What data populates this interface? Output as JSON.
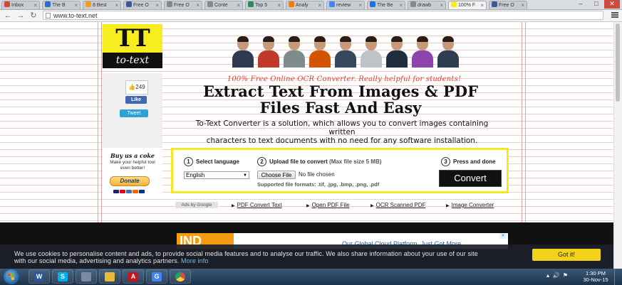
{
  "browser": {
    "tabs": [
      {
        "label": "Inbox",
        "color": "#d44638"
      },
      {
        "label": "The B",
        "color": "#2a6ed1"
      },
      {
        "label": "8 Best",
        "color": "#f0a020"
      },
      {
        "label": "Free O",
        "color": "#3b5998"
      },
      {
        "label": "Free O",
        "color": "#888888"
      },
      {
        "label": "Conte",
        "color": "#888888"
      },
      {
        "label": "Top 5",
        "color": "#2e8b57"
      },
      {
        "label": "Analy",
        "color": "#f57c00"
      },
      {
        "label": "review",
        "color": "#4285f4"
      },
      {
        "label": "The Be",
        "color": "#1a73e8"
      },
      {
        "label": "drawb",
        "color": "#888888"
      },
      {
        "label": "100% F",
        "color": "#f7ed1f"
      },
      {
        "label": "Free O",
        "color": "#3b5998"
      }
    ],
    "url": "www.to-text.net"
  },
  "site": {
    "logo_top": "TT",
    "logo_bottom": "to-text",
    "like_count": "249",
    "fb_like": "Like",
    "tweet": "Tweet",
    "tagline": "100% Free Online OCR Converter. Really helpful for students!",
    "headline_line1": "Extract Text From Images & PDF",
    "headline_line2": "Files Fast And Easy",
    "description_line1": "To-Text Converter is a solution, which allows you to convert images containing written",
    "description_line2": "characters to text documents with no need for any software installation.",
    "donate": {
      "title": "Buy us a coke",
      "subtitle_line1": "Make your helpful tool",
      "subtitle_line2": "even better!",
      "button": "Donate"
    },
    "converter": {
      "step1_num": "1",
      "step1_label": "Select language",
      "step2_num": "2",
      "step2_label": "Upload file to convert",
      "step2_note": "(Max file size 5 MB)",
      "step3_num": "3",
      "step3_label": "Press and done",
      "language_value": "English",
      "choose_file": "Choose File",
      "no_file": "No file chosen",
      "formats": "Supported file formats: .tif, .jpg, .bmp, .png, .pdf",
      "convert_button": "Convert"
    },
    "ads_by": "Ads by Google",
    "footer_links": [
      "PDF Convert Text",
      "Open PDF File",
      "OCR Scanned PDF",
      "Image Converter"
    ],
    "banner_logo": "IND",
    "banner_text": "Our Global Cloud Platform. Just Got More"
  },
  "cookie": {
    "text_line1": "We use cookies to personalise content and ads, to provide social media features and to analyse our traffic. We also share information about your use of our site",
    "text_line2": "with our social media, advertising and analytics partners.",
    "more_info": "More info",
    "button": "Got it!"
  },
  "taskbar": {
    "apps": [
      {
        "icon": "word-icon",
        "glyph": "W",
        "color": "#2b579a"
      },
      {
        "icon": "skype-icon",
        "glyph": "S",
        "color": "#00aff0"
      },
      {
        "icon": "calculator-icon",
        "glyph": "",
        "color": "#7a8aa0"
      },
      {
        "icon": "folder-icon",
        "glyph": "",
        "color": "#e8b93a"
      },
      {
        "icon": "acrobat-icon",
        "glyph": "A",
        "color": "#c4161c"
      },
      {
        "icon": "google-icon",
        "glyph": "G",
        "color": "#4285f4"
      },
      {
        "icon": "chrome-icon",
        "glyph": "",
        "color": "#dd4b39"
      }
    ],
    "time": "1:30 PM",
    "date": "30-Nov-15"
  }
}
